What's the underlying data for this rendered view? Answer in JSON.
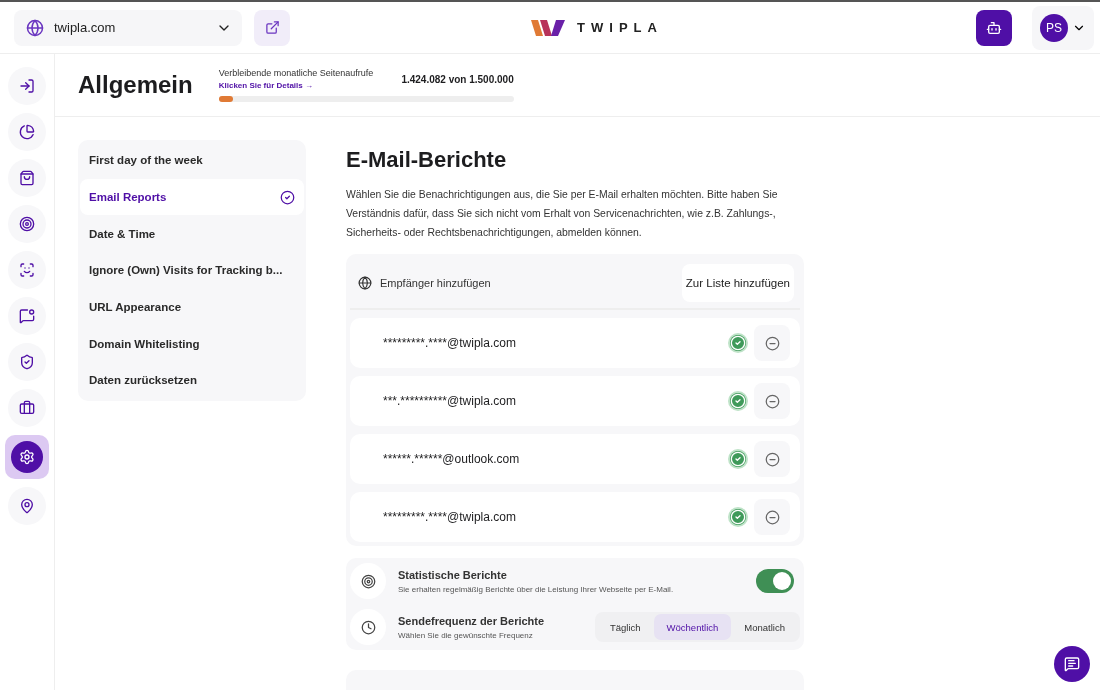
{
  "topbar": {
    "site": "twipla.com",
    "logo": "TWIPLA",
    "avatar": "PS"
  },
  "rail": [
    {
      "selected": false
    },
    {
      "selected": false
    },
    {
      "selected": false
    },
    {
      "selected": false
    },
    {
      "selected": false
    },
    {
      "selected": false
    },
    {
      "selected": false
    },
    {
      "selected": false
    },
    {
      "selected": true
    },
    {
      "selected": false
    }
  ],
  "header": {
    "title": "Allgemein",
    "quota_label": "Verbleibende monatliche Seitenaufrufe",
    "quota_link": "Klicken Sie für Details →",
    "quota_value": "1.424.082 von 1.500.000",
    "level": 0.05
  },
  "settings_nav": [
    {
      "label": "First day of the week",
      "selected": false
    },
    {
      "label": "Email Reports",
      "selected": true
    },
    {
      "label": "Date & Time",
      "selected": false
    },
    {
      "label": "Ignore (Own) Visits for Tracking b...",
      "selected": false
    },
    {
      "label": "URL Appearance",
      "selected": false
    },
    {
      "label": "Domain Whitelisting",
      "selected": false
    },
    {
      "label": "Daten zurücksetzen",
      "selected": false
    }
  ],
  "section": {
    "title": "E-Mail-Berichte",
    "description": "Wählen Sie die Benachrichtigungen aus, die Sie per E-Mail erhalten möchten. Bitte haben Sie Verständnis dafür, dass Sie sich nicht vom Erhalt von Servicenachrichten, wie z.B. Zahlungs-, Sicherheits- oder Rechtsbenachrichtigungen, abmelden können.",
    "recipient_placeholder": "Empfänger hinzufügen",
    "add_button": "Zur Liste hinzufügen",
    "recipients": [
      {
        "email": "*********.****@twipla.com",
        "verified": true
      },
      {
        "email": "***.**********@twipla.com",
        "verified": true
      },
      {
        "email": "******.******@outlook.com",
        "verified": true
      },
      {
        "email": "*********.****@twipla.com",
        "verified": true
      }
    ],
    "stats": {
      "title": "Statistische Berichte",
      "subtitle": "Sie erhalten regelmäßig Berichte über die Leistung Ihrer Webseite per E-Mail.",
      "on": true
    },
    "frequency": {
      "title": "Sendefrequenz der Berichte",
      "subtitle": "Wählen Sie die gewünschte Frequenz",
      "options": [
        {
          "label": "Täglich",
          "selected": false
        },
        {
          "label": "Wöchentlich",
          "selected": true
        },
        {
          "label": "Monatlich",
          "selected": false
        }
      ]
    }
  }
}
